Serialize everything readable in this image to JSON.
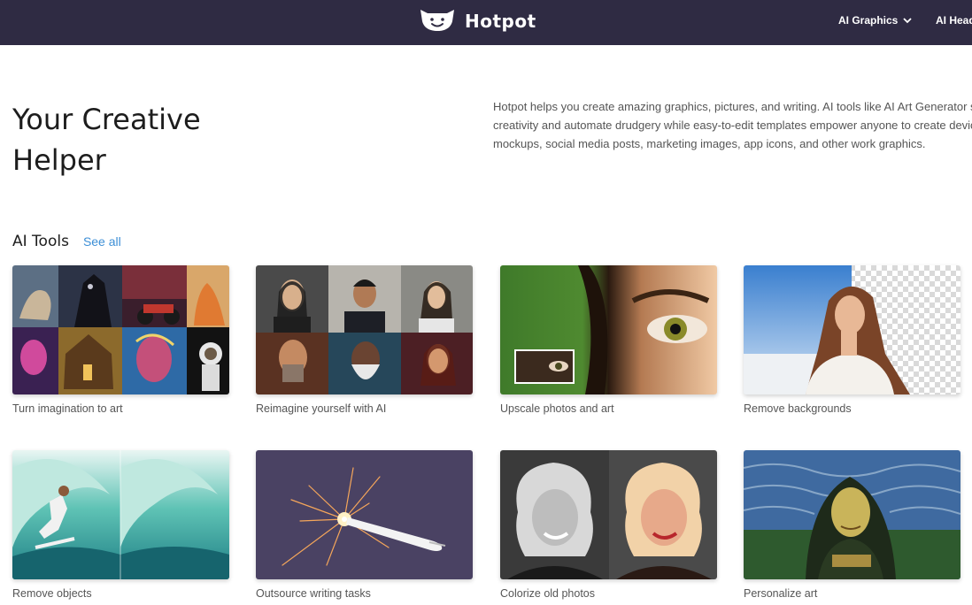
{
  "header": {
    "brand": "Hotpot",
    "brand_icon": "hotpot-face-logo",
    "nav": [
      {
        "label": "AI Graphics",
        "icon": "chevron-down-icon"
      },
      {
        "label": "AI Head"
      }
    ]
  },
  "hero": {
    "title_line1": "Your Creative",
    "title_line2": "Helper",
    "description_lines": [
      "Hotpot helps you create amazing graphics, pictures, and writing. AI tools like AI Art Generator spark",
      "creativity and automate drudgery while easy-to-edit templates empower anyone to create device",
      "mockups, social media posts, marketing images, app icons, and other work graphics."
    ]
  },
  "tools_section": {
    "title": "AI Tools",
    "see_all": "See all"
  },
  "tools": [
    {
      "label": "Turn imagination to art"
    },
    {
      "label": "Reimagine yourself with AI"
    },
    {
      "label": "Upscale photos and art"
    },
    {
      "label": "Remove backgrounds"
    },
    {
      "label": "Remove objects"
    },
    {
      "label": "Outsource writing tasks"
    },
    {
      "label": "Colorize old photos"
    },
    {
      "label": "Personalize art"
    }
  ],
  "colors": {
    "header_bg": "#2f2b43",
    "link": "#3d8fd6",
    "text_muted": "#555555"
  }
}
